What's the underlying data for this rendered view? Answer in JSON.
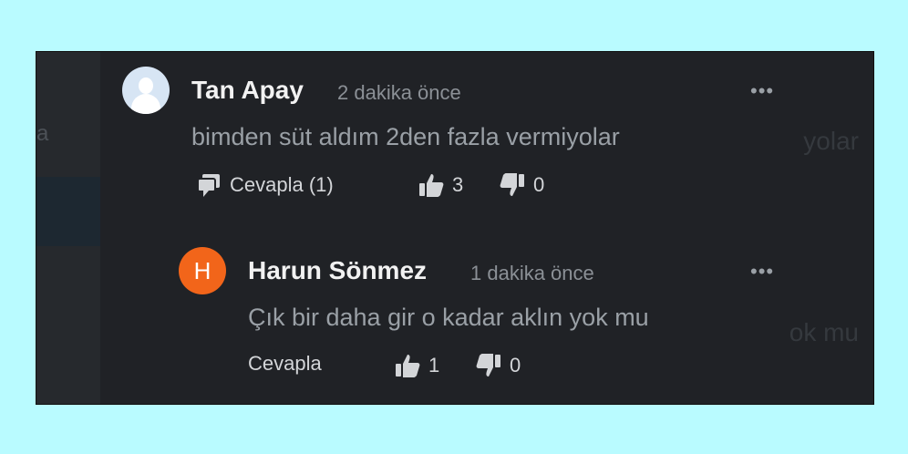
{
  "background_color": "#b9fbff",
  "panel_color": "#202226",
  "sidebar": {
    "ghost_text": "a"
  },
  "ghost_right": {
    "line1": "yolar",
    "line2": "ok mu"
  },
  "comments": [
    {
      "author": "Tan Apay",
      "time": "2 dakika önce",
      "text": "bimden süt aldım 2den fazla vermiyolar",
      "reply_label": "Cevapla (1)",
      "likes": "3",
      "dislikes": "0",
      "more_label": "•••",
      "avatar_icon": "default-user-avatar"
    },
    {
      "author": "Harun Sönmez",
      "avatar_letter": "H",
      "avatar_color": "#f2651a",
      "time": "1 dakika önce",
      "text": "Çık bir daha gir o kadar aklın yok mu",
      "reply_label": "Cevapla",
      "likes": "1",
      "dislikes": "0",
      "more_label": "•••"
    }
  ]
}
